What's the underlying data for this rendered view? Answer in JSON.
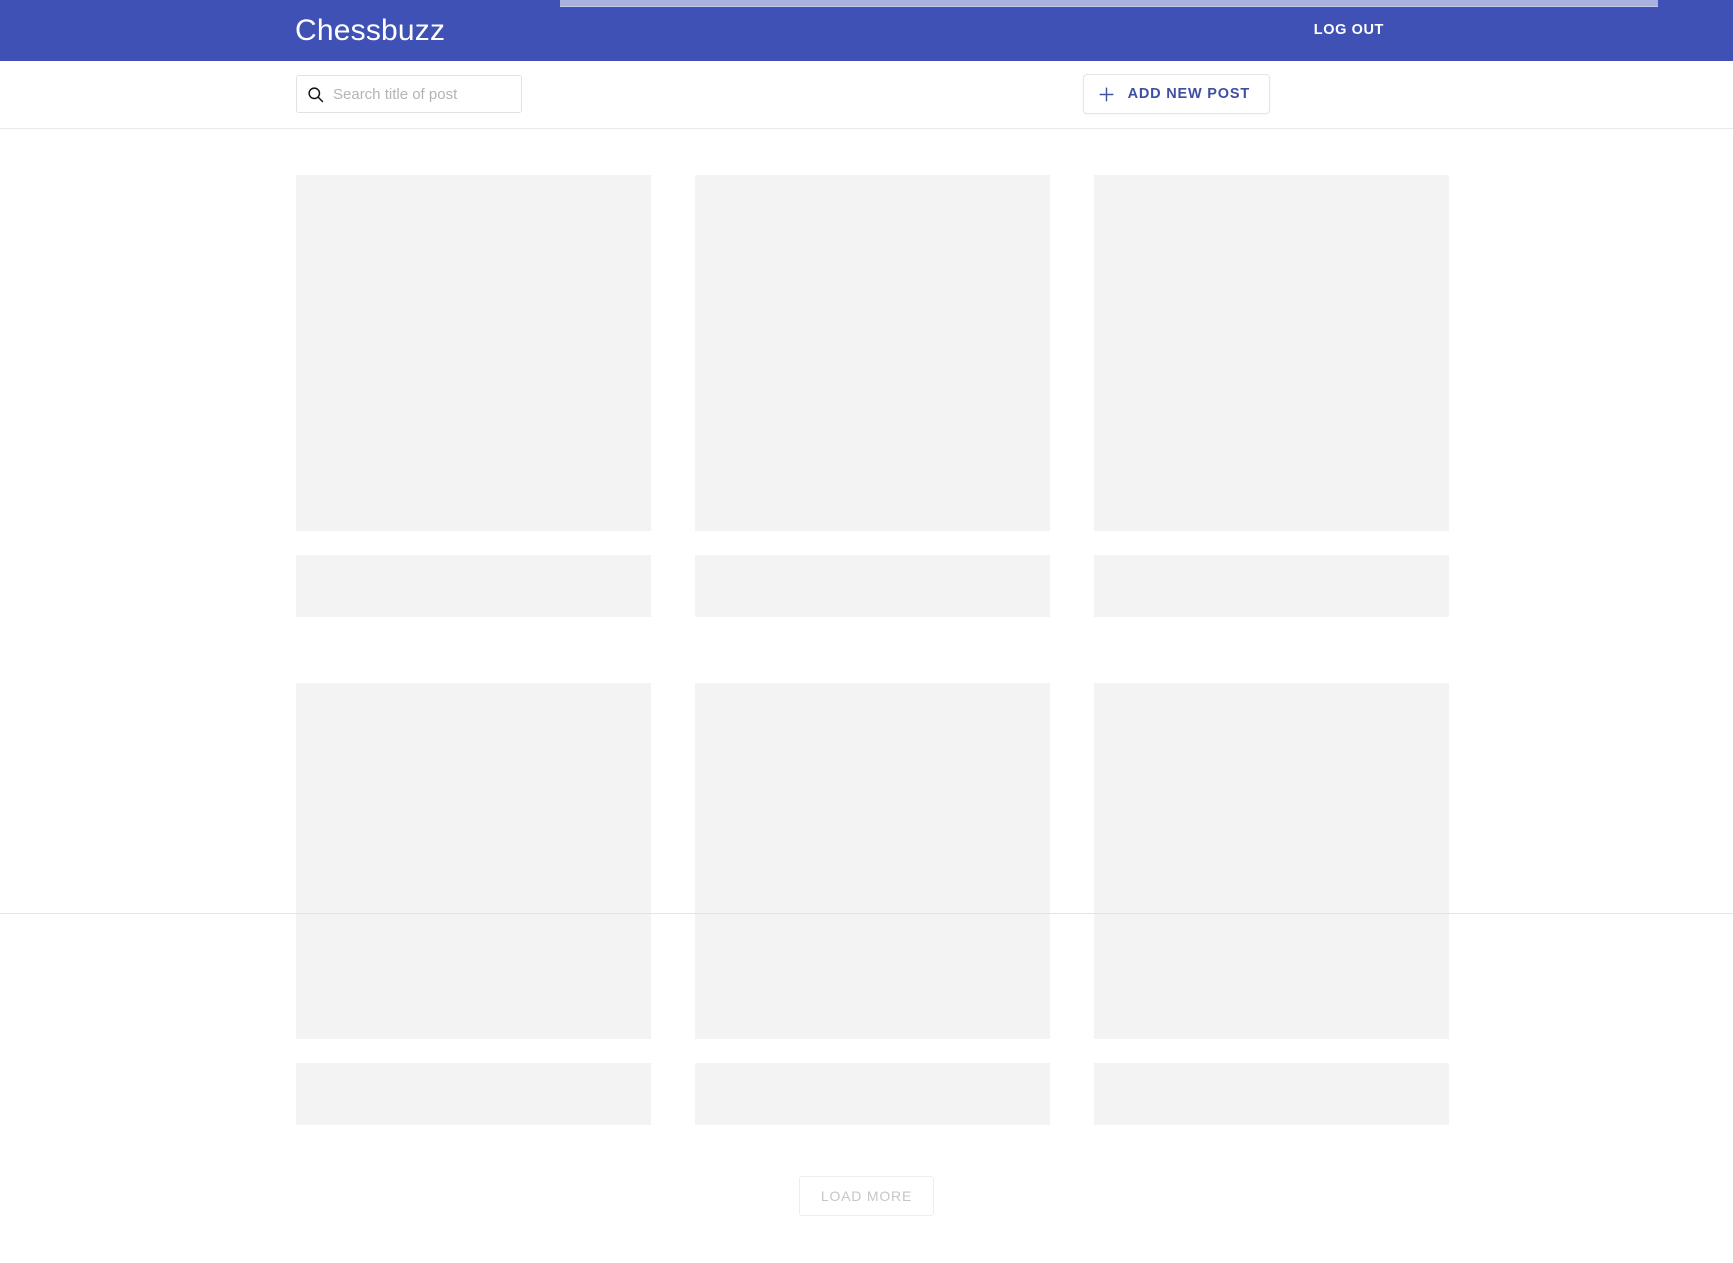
{
  "app": {
    "brand": "Chessbuzz",
    "accent_color": "#3f51b5",
    "skeleton_color": "#f3f3f3",
    "loading_progress_percent": 63
  },
  "appbar": {
    "title": "Chessbuzz",
    "logout_label": "LOG OUT"
  },
  "toolbar": {
    "search": {
      "icon": "search-icon",
      "placeholder": "Search title of post",
      "value": ""
    },
    "add_post": {
      "icon": "plus-icon",
      "label": "ADD NEW POST"
    }
  },
  "main": {
    "state": "loading",
    "skeleton": {
      "rows": 2,
      "columns": 3,
      "cards": [
        {
          "image": "",
          "title": ""
        },
        {
          "image": "",
          "title": ""
        },
        {
          "image": "",
          "title": ""
        },
        {
          "image": "",
          "title": ""
        },
        {
          "image": "",
          "title": ""
        },
        {
          "image": "",
          "title": ""
        }
      ]
    },
    "load_more_label": "LOAD MORE"
  }
}
